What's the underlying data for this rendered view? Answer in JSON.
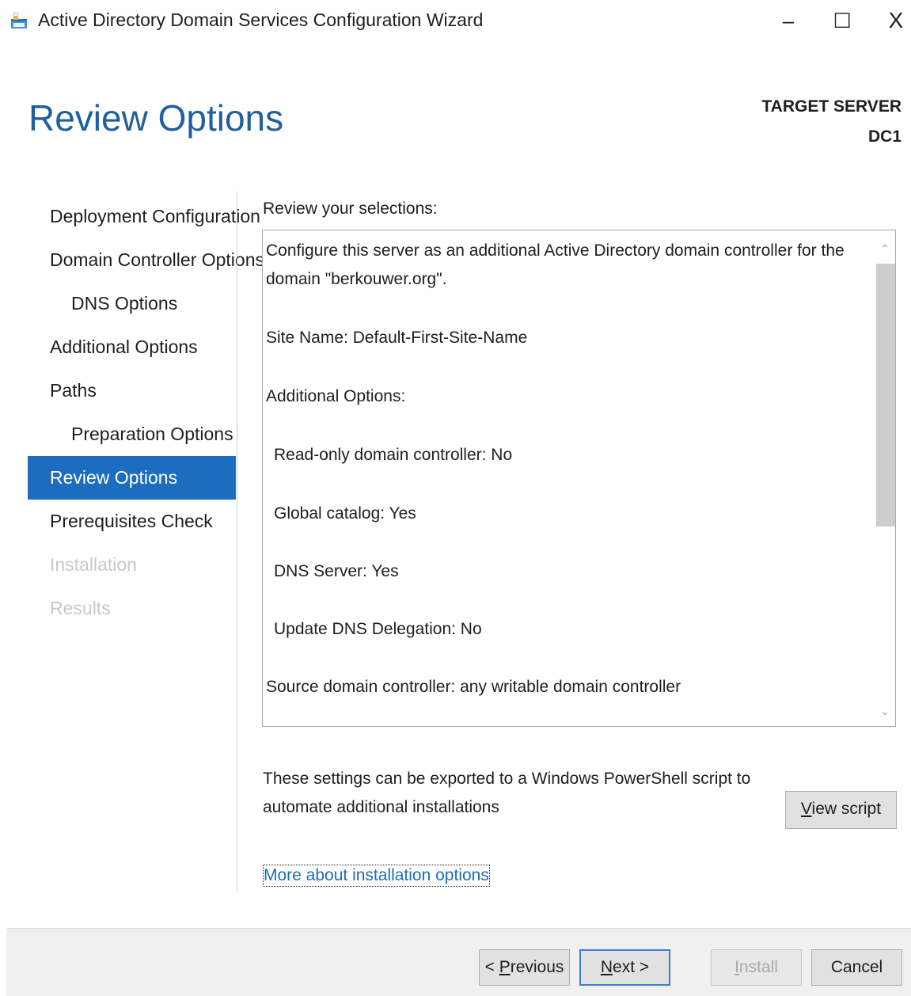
{
  "window": {
    "title": "Active Directory Domain Services Configuration Wizard",
    "minimize_glyph": "–",
    "maximize_glyph": "☐",
    "close_glyph": "X"
  },
  "header": {
    "page_title": "Review Options",
    "target_server_label": "TARGET SERVER",
    "target_server_name": "DC1"
  },
  "nav": {
    "items": [
      {
        "label": "Deployment Configuration",
        "state": "normal"
      },
      {
        "label": "Domain Controller Options",
        "state": "normal"
      },
      {
        "label": "DNS Options",
        "state": "normal"
      },
      {
        "label": "Additional Options",
        "state": "normal"
      },
      {
        "label": "Paths",
        "state": "normal"
      },
      {
        "label": "Preparation Options",
        "state": "normal"
      },
      {
        "label": "Review Options",
        "state": "active"
      },
      {
        "label": "Prerequisites Check",
        "state": "normal"
      },
      {
        "label": "Installation",
        "state": "disabled"
      },
      {
        "label": "Results",
        "state": "disabled"
      }
    ]
  },
  "main": {
    "review_label": "Review your selections:",
    "review_lines": [
      "Configure this server as an additional Active Directory domain controller for the domain \"berkouwer.org\".",
      "Site Name: Default-First-Site-Name",
      "Additional Options:",
      "Read-only domain controller: No",
      "Global catalog: Yes",
      "DNS Server: Yes",
      "Update DNS Delegation: No",
      "Source domain controller: any writable domain controller"
    ],
    "export_text": "These settings can be exported to a Windows PowerShell script to automate additional installations",
    "view_script": {
      "mnemonic": "V",
      "rest": "iew script"
    },
    "more_link": "More about installation options"
  },
  "footer": {
    "previous": {
      "prefix": "< ",
      "mnemonic": "P",
      "rest": "revious"
    },
    "next": {
      "mnemonic": "N",
      "rest": "ext >"
    },
    "install": {
      "mnemonic": "I",
      "rest": "nstall"
    },
    "cancel": "Cancel"
  },
  "colors": {
    "accent": "#1c6cbf",
    "title_blue": "#1e5f9e",
    "disabled_text": "#c8c8c8"
  }
}
